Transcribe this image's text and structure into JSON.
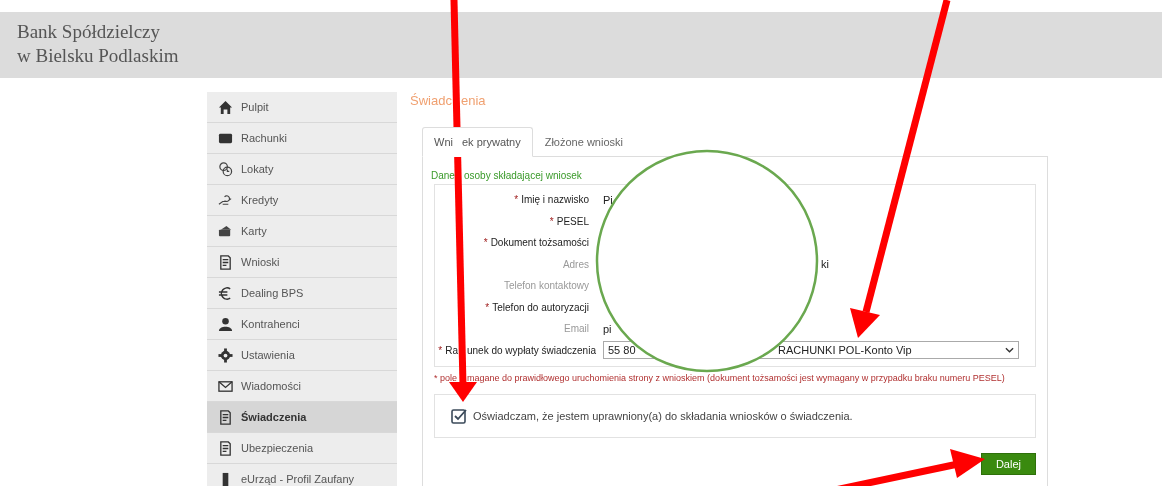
{
  "bank_name": [
    "Bank Spółdzielczy",
    "w Bielsku Podlaskim"
  ],
  "sidebar": {
    "items": [
      {
        "label": "Pulpit",
        "selected": false
      },
      {
        "label": "Rachunki",
        "selected": false
      },
      {
        "label": "Lokaty",
        "selected": false
      },
      {
        "label": "Kredyty",
        "selected": false
      },
      {
        "label": "Karty",
        "selected": false
      },
      {
        "label": "Wnioski",
        "selected": false
      },
      {
        "label": "Dealing BPS",
        "selected": false
      },
      {
        "label": "Kontrahenci",
        "selected": false
      },
      {
        "label": "Ustawienia",
        "selected": false
      },
      {
        "label": "Wiadomości",
        "selected": false
      },
      {
        "label": "Świadczenia",
        "selected": true
      },
      {
        "label": "Ubezpieczenia",
        "selected": false
      },
      {
        "label": "eUrząd - Profil Zaufany",
        "selected": false
      }
    ]
  },
  "page_title": [
    "Świadc",
    "enia"
  ],
  "tabs": [
    {
      "label": [
        "Wni",
        "ek prywatny"
      ],
      "selected": true
    },
    {
      "label": [
        "Złożone wnioski"
      ],
      "selected": false
    }
  ],
  "section_title": [
    "Dane",
    "osoby składającej wniosek"
  ],
  "fields": [
    {
      "required_mark": "*",
      "label": [
        "Imię i nazwisko"
      ],
      "value": "Pi"
    },
    {
      "required_mark": "*",
      "label": [
        "PESEL"
      ]
    },
    {
      "required_mark": "*",
      "label": [
        "Dokument tożsamości"
      ]
    },
    {
      "label": [
        "Adres"
      ],
      "value_tail": "ki"
    },
    {
      "label": [
        "Telefon kontaktowy"
      ]
    },
    {
      "required_mark": "*",
      "label": [
        "Telefon do autoryzacji"
      ]
    },
    {
      "label": [
        "Email"
      ],
      "value": "pi"
    },
    {
      "required_mark": "*",
      "label": [
        "Ra",
        "unek do wypłaty świadczenia"
      ],
      "kind": "select",
      "value": "55 80",
      "value_tail": "RACHUNKI POL-Konto Vip"
    }
  ],
  "required_note": [
    "* pole",
    "magane do prawidłowego uruchomienia strony z wnioskiem (dokument tożsamości jest wymagany w przypadku braku numeru PESEL)"
  ],
  "declaration": {
    "label": "Oświadczam, że jestem uprawniony(a) do składania wniosków o świadczenia.",
    "checked": true
  },
  "next_button": "Dalej"
}
